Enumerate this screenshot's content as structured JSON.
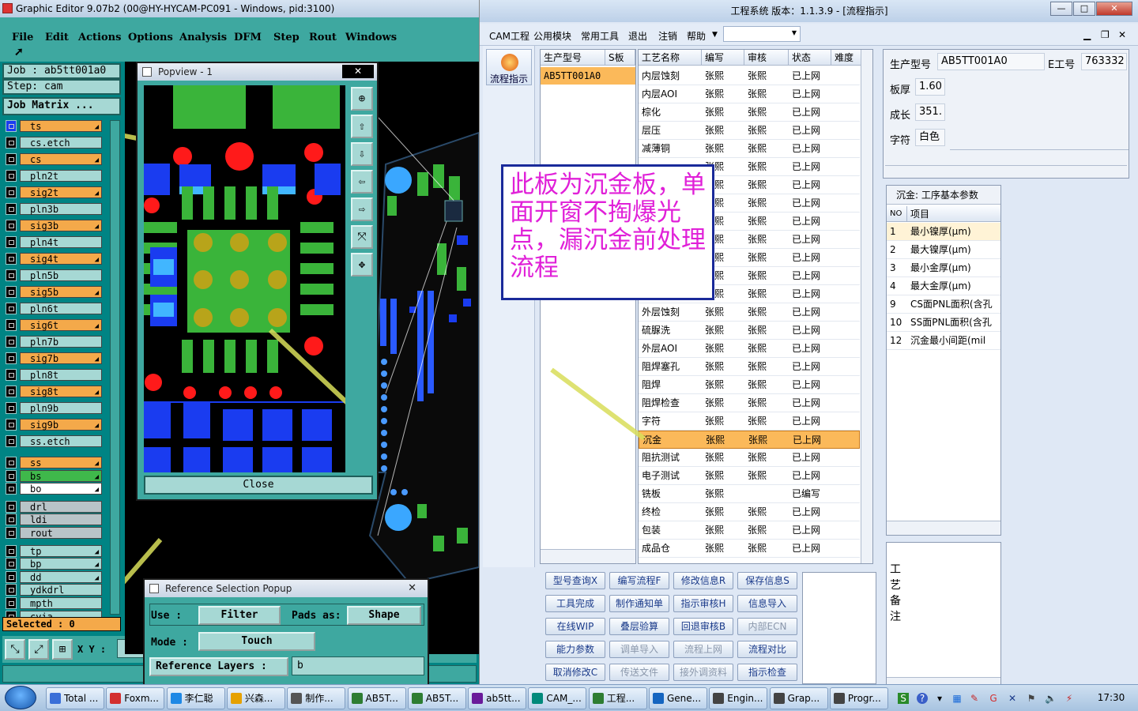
{
  "genesis": {
    "title": "Graphic Editor 9.07b2 (00@HY-HYCAM-PC091 - Windows, pid:3100)",
    "menu": [
      "File",
      "Edit",
      "Actions",
      "Options",
      "Analysis",
      "DFM",
      "Step",
      "Rout",
      "Windows"
    ],
    "job": "Job : ab5tt001a0",
    "step": "Step: cam",
    "job_matrix": "Job Matrix ...",
    "layers": [
      {
        "name": "ts",
        "color": "#f4a94a",
        "mark": "◢"
      },
      {
        "name": "cs.etch",
        "color": "#a6d8d4",
        "mark": ""
      },
      {
        "name": "cs",
        "color": "#f4a94a",
        "mark": "◢"
      },
      {
        "name": "pln2t",
        "color": "#a6d8d4",
        "mark": ""
      },
      {
        "name": "sig2t",
        "color": "#f4a94a",
        "mark": "◢"
      },
      {
        "name": "pln3b",
        "color": "#a6d8d4",
        "mark": ""
      },
      {
        "name": "sig3b",
        "color": "#f4a94a",
        "mark": "◢"
      },
      {
        "name": "pln4t",
        "color": "#a6d8d4",
        "mark": ""
      },
      {
        "name": "sig4t",
        "color": "#f4a94a",
        "mark": "◢"
      },
      {
        "name": "pln5b",
        "color": "#a6d8d4",
        "mark": ""
      },
      {
        "name": "sig5b",
        "color": "#f4a94a",
        "mark": "◢"
      },
      {
        "name": "pln6t",
        "color": "#a6d8d4",
        "mark": ""
      },
      {
        "name": "sig6t",
        "color": "#f4a94a",
        "mark": "◢"
      },
      {
        "name": "pln7b",
        "color": "#a6d8d4",
        "mark": ""
      },
      {
        "name": "sig7b",
        "color": "#f4a94a",
        "mark": "◢"
      },
      {
        "name": "pln8t",
        "color": "#a6d8d4",
        "mark": ""
      },
      {
        "name": "sig8t",
        "color": "#f4a94a",
        "mark": "◢"
      },
      {
        "name": "pln9b",
        "color": "#a6d8d4",
        "mark": ""
      },
      {
        "name": "sig9b",
        "color": "#f4a94a",
        "mark": "◢"
      },
      {
        "name": "ss.etch",
        "color": "#a6d8d4",
        "mark": ""
      },
      {
        "name": "ss",
        "color": "#f4a94a",
        "mark": "◢"
      },
      {
        "name": "bs",
        "color": "#3fb84b",
        "mark": "◢"
      },
      {
        "name": "bo",
        "color": "#ffffff",
        "mark": "◢"
      },
      {
        "name": "drl",
        "color": "#b8c4c8",
        "mark": ""
      },
      {
        "name": "ldi",
        "color": "#b8c4c8",
        "mark": ""
      },
      {
        "name": "rout",
        "color": "#b8c4c8",
        "mark": ""
      },
      {
        "name": "tp",
        "color": "#a6d8d4",
        "mark": "◢"
      },
      {
        "name": "bp",
        "color": "#a6d8d4",
        "mark": "◢"
      },
      {
        "name": "dd",
        "color": "#a6d8d4",
        "mark": "◢"
      },
      {
        "name": "ydkdrl",
        "color": "#a6d8d4",
        "mark": ""
      },
      {
        "name": "mpth",
        "color": "#a6d8d4",
        "mark": ""
      },
      {
        "name": "cvia",
        "color": "#a6d8d4",
        "mark": ""
      }
    ],
    "selected": "Selected : 0",
    "xy_label": "X Y :",
    "canvas_fragment": "mer"
  },
  "popview": {
    "title": "Popview - 1",
    "close": "Close"
  },
  "refpopup": {
    "title": "Reference Selection Popup",
    "use_label": "Use :",
    "use_value": "Filter",
    "pads_label": "Pads as:",
    "pads_value": "Shape",
    "mode_label": "Mode :",
    "mode_value": "Touch",
    "layers_label": "Reference Layers :",
    "layers_value": "b"
  },
  "cam": {
    "title": "工程系统  版本：1.1.3.9 - [流程指示]",
    "menu": [
      "CAM工程",
      "公用模块",
      "常用工具",
      "退出",
      "注销",
      "帮助"
    ],
    "left_button": "流程指示",
    "parts_headers": [
      "生产型号",
      "S板"
    ],
    "part": "AB5TT001A0",
    "proc_headers": [
      "工艺名称",
      "编写",
      "审核",
      "状态",
      "难度"
    ],
    "processes": [
      [
        "内层蚀刻",
        "张熙",
        "张熙",
        "已上网"
      ],
      [
        "内层AOI",
        "张熙",
        "张熙",
        "已上网"
      ],
      [
        "棕化",
        "张熙",
        "张熙",
        "已上网"
      ],
      [
        "层压",
        "张熙",
        "张熙",
        "已上网"
      ],
      [
        "减薄铜",
        "张熙",
        "张熙",
        "已上网"
      ],
      [
        "",
        "张熙",
        "张熙",
        "已上网"
      ],
      [
        "",
        "张熙",
        "张熙",
        "已上网"
      ],
      [
        "",
        "张熙",
        "张熙",
        "已上网"
      ],
      [
        "",
        "张熙",
        "张熙",
        "已上网"
      ],
      [
        "",
        "张熙",
        "张熙",
        "已上网"
      ],
      [
        "",
        "张熙",
        "张熙",
        "已上网"
      ],
      [
        "",
        "张熙",
        "张熙",
        "已上网"
      ],
      [
        "",
        "张熙",
        "张熙",
        "已上网"
      ],
      [
        "外层蚀刻",
        "张熙",
        "张熙",
        "已上网"
      ],
      [
        "硫脲洗",
        "张熙",
        "张熙",
        "已上网"
      ],
      [
        "外层AOI",
        "张熙",
        "张熙",
        "已上网"
      ],
      [
        "阻焊塞孔",
        "张熙",
        "张熙",
        "已上网"
      ],
      [
        "阻焊",
        "张熙",
        "张熙",
        "已上网"
      ],
      [
        "阻焊检查",
        "张熙",
        "张熙",
        "已上网"
      ],
      [
        "字符",
        "张熙",
        "张熙",
        "已上网"
      ],
      [
        "沉金",
        "张熙",
        "张熙",
        "已上网"
      ],
      [
        "阻抗测试",
        "张熙",
        "张熙",
        "已上网"
      ],
      [
        "电子测试",
        "张熙",
        "张熙",
        "已上网"
      ],
      [
        "铣板",
        "张熙",
        "",
        "已编写"
      ],
      [
        "终检",
        "张熙",
        "张熙",
        "已上网"
      ],
      [
        "包装",
        "张熙",
        "张熙",
        "已上网"
      ],
      [
        "成品仓",
        "张熙",
        "张熙",
        "已上网"
      ]
    ],
    "selected_process": "沉金",
    "buttons": [
      [
        "型号查询X",
        "编写流程F",
        "修改信息R",
        "保存信息S"
      ],
      [
        "工具完成",
        "制作通知单",
        "指示审核H",
        "信息导入"
      ],
      [
        "在线WIP",
        "叠层验算",
        "回退审核B",
        "内部ECN"
      ],
      [
        "能力参数",
        "调单导入",
        "流程上网",
        "流程对比"
      ],
      [
        "取消修改C",
        "传送文件",
        "接外调资料",
        "指示检查"
      ]
    ],
    "disabled_buttons": [
      "内部ECN",
      "调单导入",
      "流程上网",
      "传送文件",
      "接外调资料"
    ],
    "info": {
      "part_label": "生产型号",
      "part_value": "AB5TT001A0",
      "e_label": "E工号",
      "e_value": "763332",
      "thick_label": "板厚",
      "thick_value": "1.60",
      "grow_label": "成长",
      "grow_value": "351.",
      "char_label": "字符",
      "char_value": "白色"
    },
    "params_title": "沉金: 工序基本参数",
    "params_headers": [
      "NO",
      "项目"
    ],
    "params": [
      [
        "1",
        "最小镍厚(μm)"
      ],
      [
        "2",
        "最大镍厚(μm)"
      ],
      [
        "3",
        "最小金厚(μm)"
      ],
      [
        "4",
        "最大金厚(μm)"
      ],
      [
        "9",
        "CS面PNL面积(含孔"
      ],
      [
        "10",
        "SS面PNL面积(含孔"
      ],
      [
        "12",
        "沉金最小间距(mil"
      ]
    ],
    "notes_label": "工艺备注"
  },
  "annotation": "此板为沉金板，单面开窗不掏爆光点，漏沉金前处理流程",
  "taskbar": {
    "items": [
      "Total ...",
      "Foxm...",
      "李仁聪",
      "兴森...",
      "制作...",
      "AB5T...",
      "AB5T...",
      "ab5tt...",
      "CAM_...",
      "工程...",
      "Gene...",
      "Engin...",
      "Grap...",
      "Progr..."
    ],
    "clock": "17:30"
  }
}
